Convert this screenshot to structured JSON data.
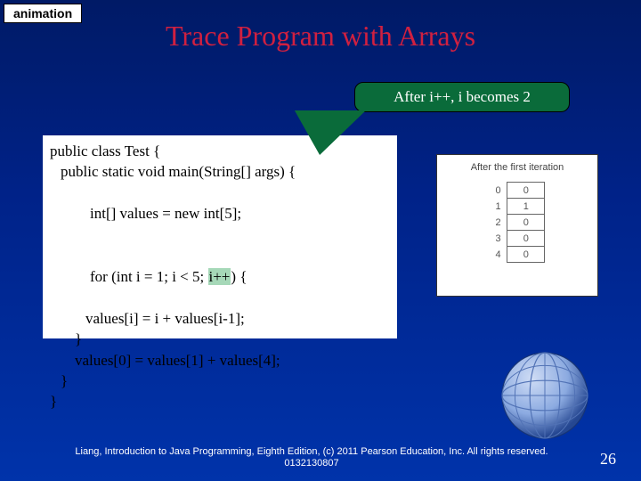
{
  "tag": "animation",
  "title": "Trace Program with Arrays",
  "callout": "After i++, i becomes 2",
  "code": {
    "l1": "public class Test {",
    "l2": "public static void main(String[] args) {",
    "l3a": "int[] values = ",
    "l3b": "new int[5];",
    "l4a": "for (int i = 1; i < 5; ",
    "l4b": "i++",
    "l4c": ") {",
    "l5": "values[i] = i + values[i-1];",
    "l6": "}",
    "l7": "values[0] = values[1] + values[4];",
    "l8": "}",
    "l9": "}"
  },
  "table": {
    "caption": "After the first iteration",
    "rows": [
      {
        "idx": "0",
        "val": "0"
      },
      {
        "idx": "1",
        "val": "1"
      },
      {
        "idx": "2",
        "val": "0"
      },
      {
        "idx": "3",
        "val": "0"
      },
      {
        "idx": "4",
        "val": "0"
      }
    ]
  },
  "footer": "Liang, Introduction to Java Programming, Eighth Edition, (c) 2011 Pearson Education, Inc. All rights reserved. 0132130807",
  "page": "26"
}
